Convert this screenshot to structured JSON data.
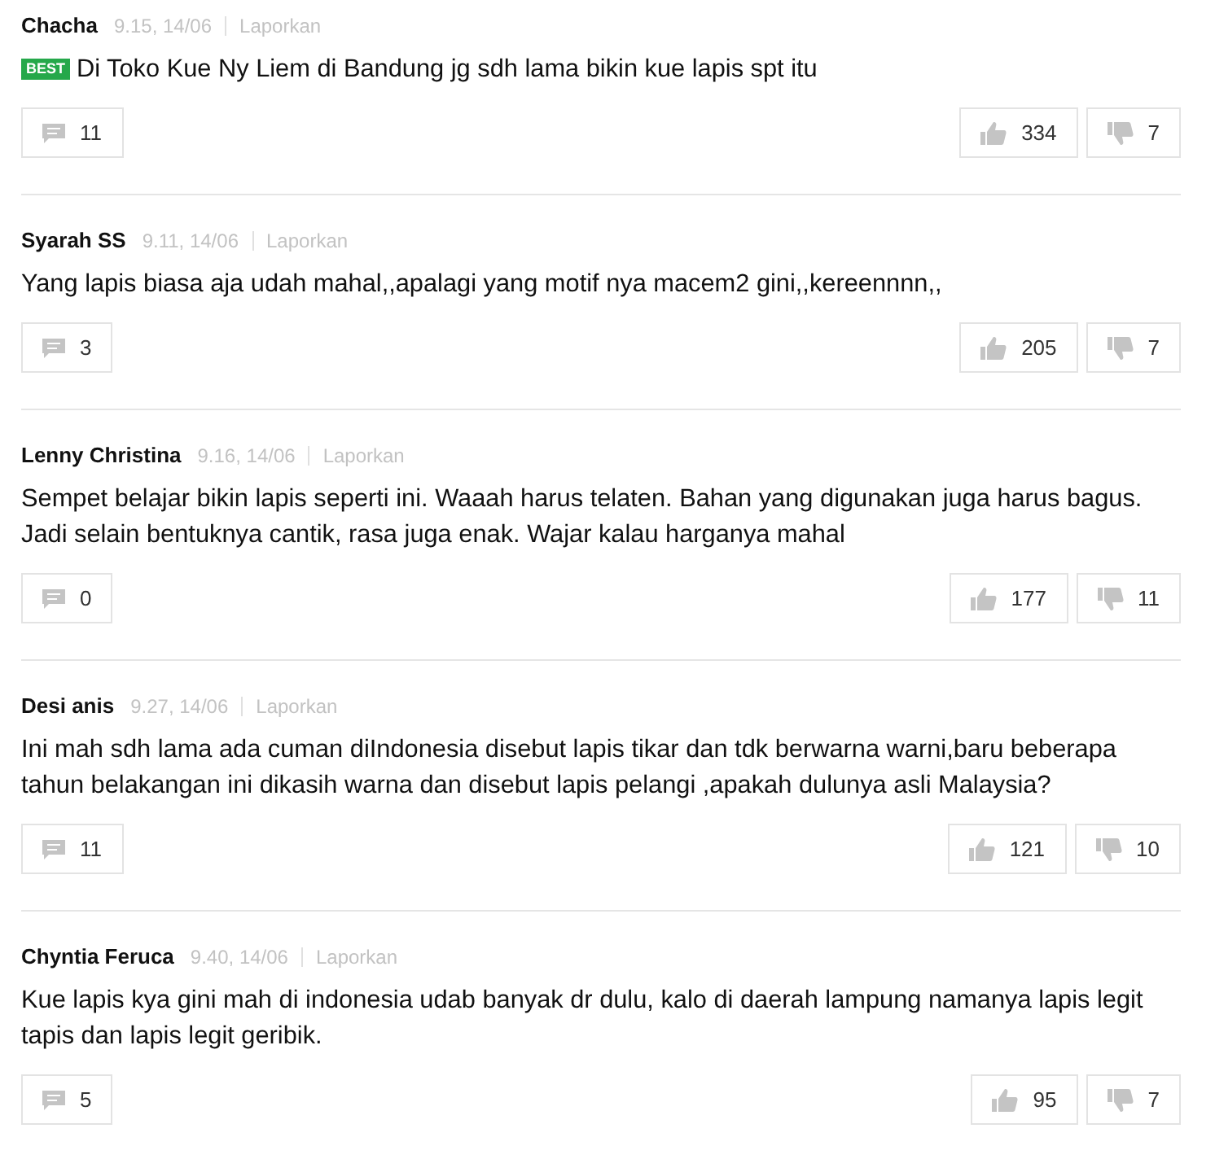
{
  "comments": [
    {
      "author": "Chacha",
      "time": "9.15, 14/06",
      "report": "Laporkan",
      "badge": "BEST",
      "text": "Di Toko Kue Ny Liem di Bandung jg sdh lama bikin kue lapis spt itu",
      "replies": "11",
      "likes": "334",
      "dislikes": "7"
    },
    {
      "author": "Syarah SS",
      "time": "9.11, 14/06",
      "report": "Laporkan",
      "text": "Yang lapis biasa aja udah mahal,,apalagi yang motif nya macem2 gini,,kereennnn,,",
      "replies": "3",
      "likes": "205",
      "dislikes": "7"
    },
    {
      "author": "Lenny Christina",
      "time": "9.16, 14/06",
      "report": "Laporkan",
      "text": "Sempet belajar bikin lapis seperti ini. Waaah harus telaten. Bahan yang digunakan juga harus bagus. Jadi selain bentuknya cantik, rasa juga enak. Wajar kalau harganya mahal",
      "replies": "0",
      "likes": "177",
      "dislikes": "11"
    },
    {
      "author": "Desi anis",
      "time": "9.27, 14/06",
      "report": "Laporkan",
      "text": "Ini mah sdh lama ada cuman diIndonesia disebut lapis tikar dan tdk berwarna warni,baru beberapa tahun belakangan ini dikasih warna dan disebut lapis pelangi ,apakah dulunya asli Malaysia?",
      "replies": "11",
      "likes": "121",
      "dislikes": "10"
    },
    {
      "author": "Chyntia Feruca",
      "time": "9.40, 14/06",
      "report": "Laporkan",
      "text": "Kue lapis kya gini mah di indonesia udab banyak dr dulu, kalo di daerah lampung namanya lapis legit tapis dan lapis legit geribik.",
      "replies": "5",
      "likes": "95",
      "dislikes": "7"
    }
  ]
}
